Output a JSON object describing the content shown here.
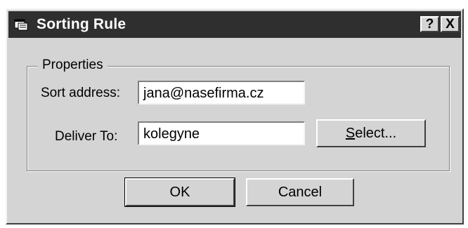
{
  "window": {
    "title": "Sorting Rule",
    "help_button": "?",
    "close_button": "X"
  },
  "properties": {
    "legend": "Properties",
    "sort_address_label": "Sort address:",
    "sort_address_value": "jana@nasefirma.cz",
    "deliver_to_label": "Deliver To:",
    "deliver_to_value": "kolegyne",
    "select_button_accel": "S",
    "select_button_rest": "elect..."
  },
  "buttons": {
    "ok": "OK",
    "cancel": "Cancel"
  }
}
